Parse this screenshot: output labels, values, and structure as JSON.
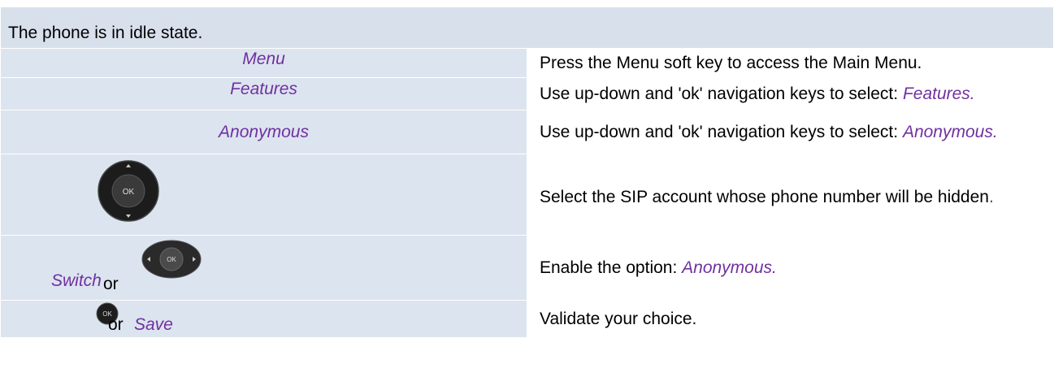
{
  "header": {
    "text": "The phone is in idle state."
  },
  "rows": [
    {
      "key": "Menu",
      "desc": "Press the Menu soft key to access the Main Menu."
    },
    {
      "key": "Features",
      "desc_prefix": "Use up-down and 'ok' navigation keys to select: ",
      "desc_em": "Features."
    },
    {
      "key": "Anonymous",
      "desc_prefix": "Use up-down and 'ok' navigation keys to select: ",
      "desc_em": "Anonymous."
    },
    {
      "key_icon": "ok-navigation-pad-icon",
      "key_icon_text": "OK",
      "desc": "Select the SIP account whose phone number will be hidden",
      "desc_end": "."
    },
    {
      "key": "Switch",
      "or": "or",
      "key_icon": "left-right-ok-pad-icon",
      "key_icon_text": "OK",
      "desc_prefix": "Enable the option: ",
      "desc_em": "Anonymous."
    },
    {
      "key_icon": "ok-button-icon",
      "key_icon_text": "OK",
      "or": "or",
      "key": "Save",
      "desc": "Validate your choice."
    }
  ],
  "colors": {
    "header_bg": "#d8e0ec",
    "key_bg": "#dce4ef",
    "accent_text": "#7030a0"
  }
}
